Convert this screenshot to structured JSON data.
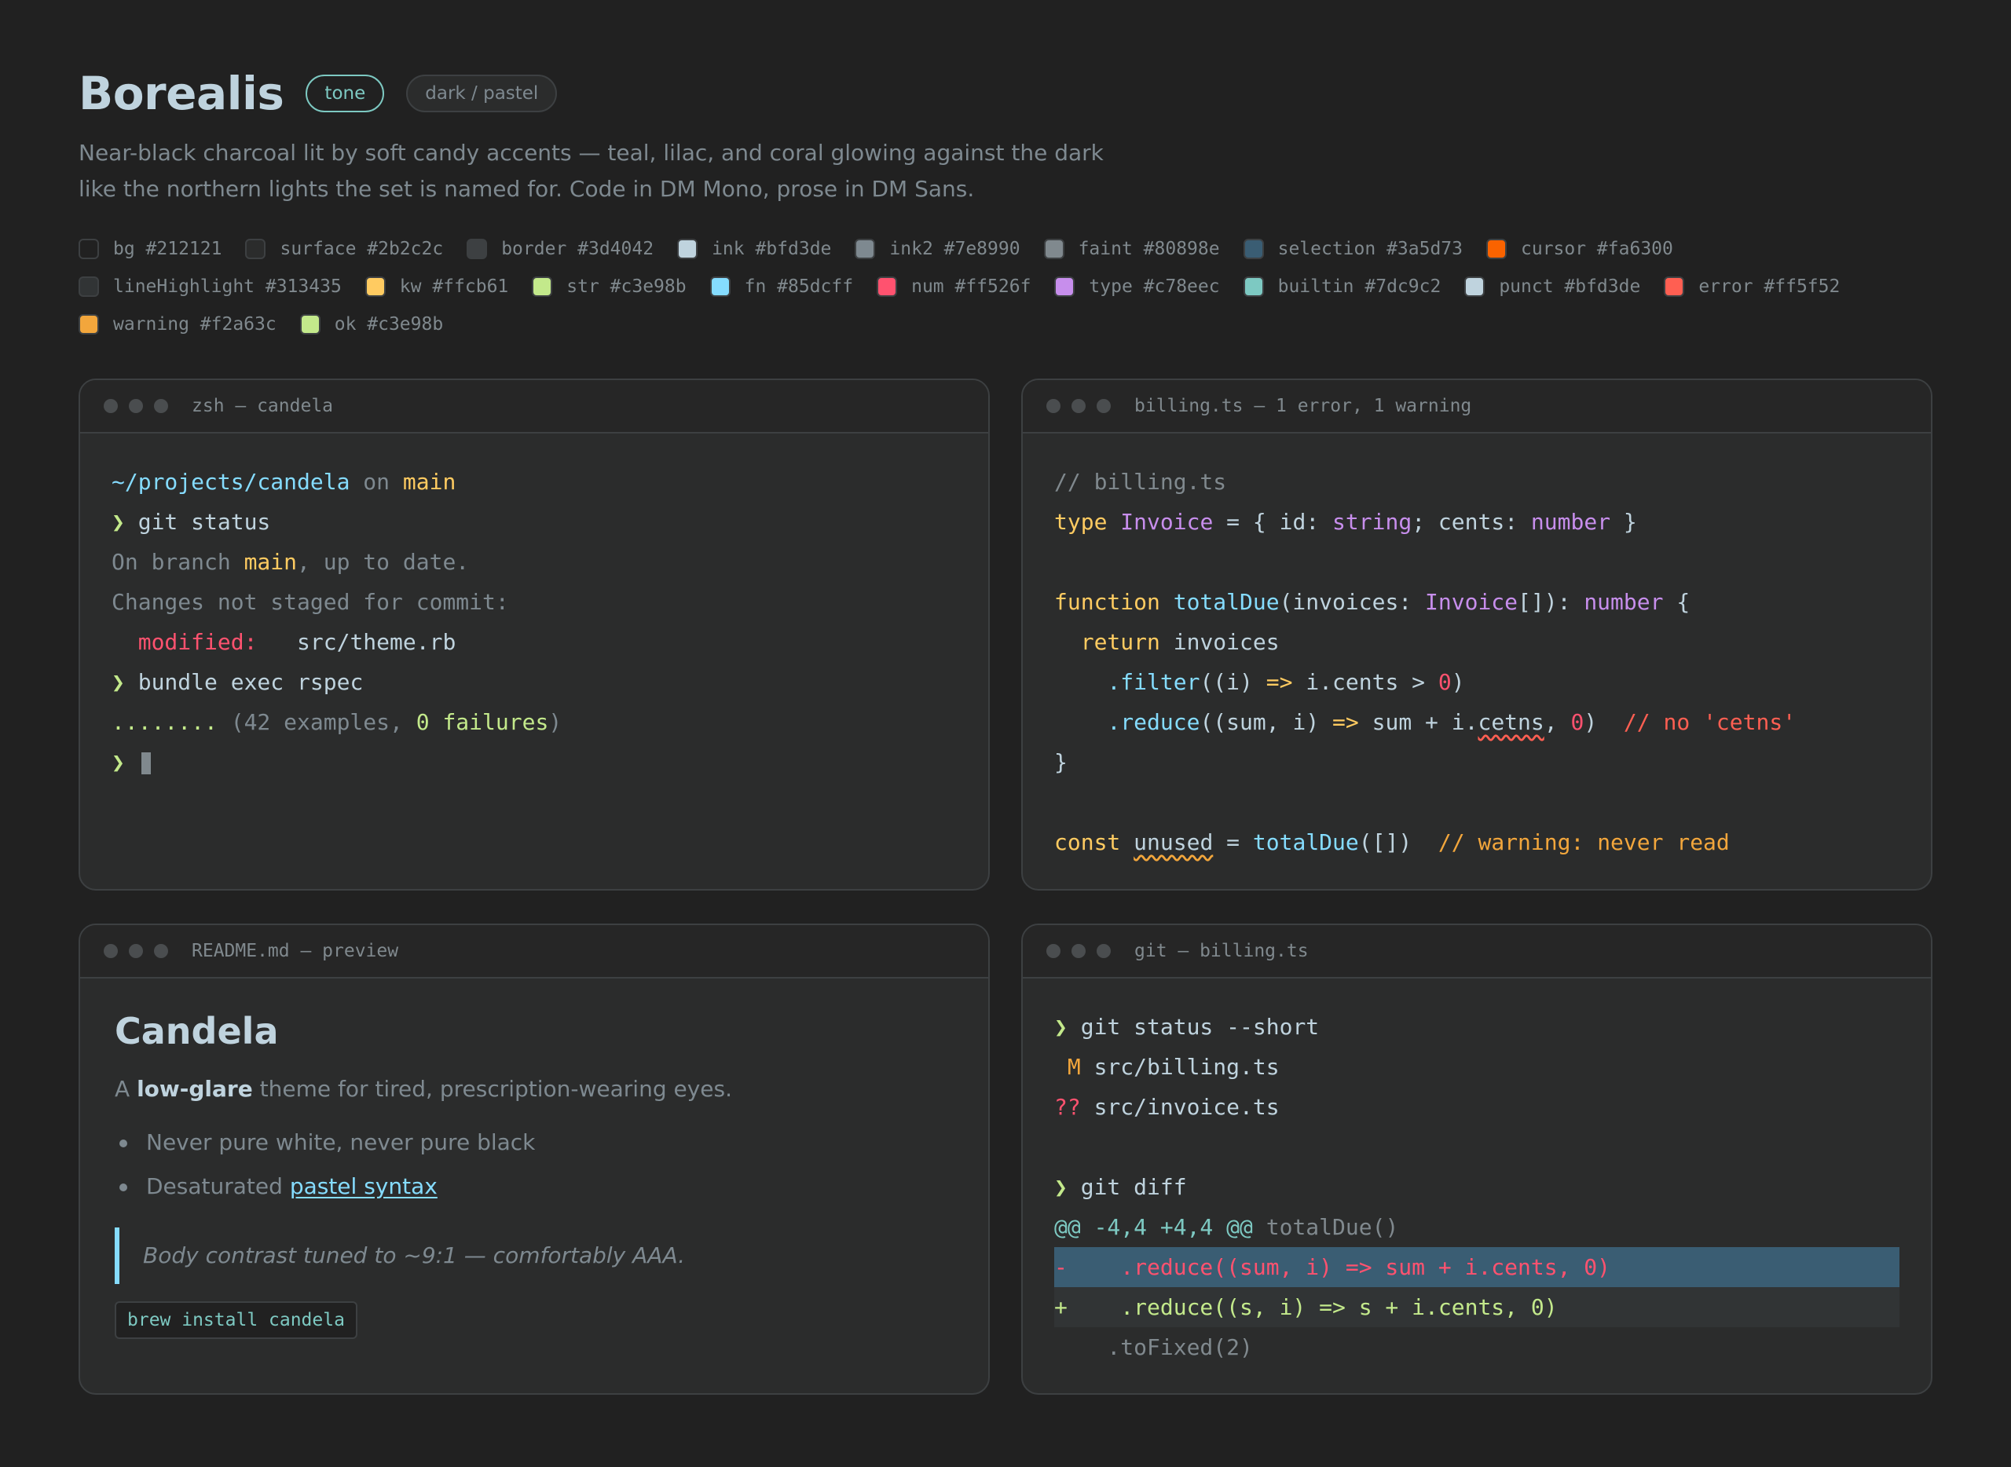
{
  "header": {
    "title": "Borealis",
    "tag_tone": "tone",
    "tag_mode": "dark / pastel",
    "description": "Near-black charcoal lit by soft candy accents — teal, lilac, and coral glowing against the dark like the northern lights the set is named for. Code in DM Mono, prose in DM Sans."
  },
  "palette": [
    {
      "label": "bg #212121",
      "color": "#212121"
    },
    {
      "label": "surface #2b2c2c",
      "color": "#2b2c2c"
    },
    {
      "label": "border #3d4042",
      "color": "#3d4042"
    },
    {
      "label": "ink #bfd3de",
      "color": "#bfd3de"
    },
    {
      "label": "ink2 #7e8990",
      "color": "#7e8990"
    },
    {
      "label": "faint #80898e",
      "color": "#80898e"
    },
    {
      "label": "selection #3a5d73",
      "color": "#3a5d73"
    },
    {
      "label": "cursor #fa6300",
      "color": "#fa6300"
    },
    {
      "label": "lineHighlight #313435",
      "color": "#313435"
    },
    {
      "label": "kw #ffcb61",
      "color": "#ffcb61"
    },
    {
      "label": "str #c3e98b",
      "color": "#c3e98b"
    },
    {
      "label": "fn #85dcff",
      "color": "#85dcff"
    },
    {
      "label": "num #ff526f",
      "color": "#ff526f"
    },
    {
      "label": "type #c78eec",
      "color": "#c78eec"
    },
    {
      "label": "builtin #7dc9c2",
      "color": "#7dc9c2"
    },
    {
      "label": "punct #bfd3de",
      "color": "#bfd3de"
    },
    {
      "label": "error #ff5f52",
      "color": "#ff5f52"
    },
    {
      "label": "warning #f2a63c",
      "color": "#f2a63c"
    },
    {
      "label": "ok #c3e98b",
      "color": "#c3e98b"
    }
  ],
  "terminal": {
    "title": "zsh — candela",
    "path": "~/projects/candela",
    "on": "on",
    "branch": "main",
    "prompt": "❯",
    "cmd1": "git status",
    "on_branch_prefix": "On branch ",
    "on_branch_suffix": ", up to date.",
    "changes": "Changes not staged for commit:",
    "modified_label": "modified:",
    "modified_file": "src/theme.rb",
    "cmd2": "bundle exec rspec",
    "dots": "........",
    "examples_open": "(42 examples, ",
    "failures": "0 failures",
    "examples_close": ")"
  },
  "editor": {
    "title": "billing.ts — 1 error, 1 warning",
    "comment": "// billing.ts",
    "kw_type": "type",
    "type_invoice": "Invoice",
    "eq_open": " = { id: ",
    "t_string": "string",
    "cents_sep": "; cents: ",
    "t_number": "number",
    "close_brace": " }",
    "kw_function": "function",
    "fn_total": "totalDue",
    "params_open": "(invoices: ",
    "params_arr": "[]): ",
    "open_brace": " {",
    "kw_return": "return",
    "invoices": " invoices",
    "filter": ".filter",
    "filter_args": "((i) ",
    "arrow": "=>",
    "filter_body": " i.cents > ",
    "zero": "0",
    "rparen": ")",
    "reduce": ".reduce",
    "reduce_args": "((sum, i) ",
    "reduce_body": " sum + i.",
    "cetns": "cetns",
    "comma_sp": ", ",
    "err_comment": "// no 'cetns'",
    "rbrace": "}",
    "kw_const": "const",
    "unused": "unused",
    "eq": " = ",
    "call_args": "([])",
    "warn_comment": "// warning: never read"
  },
  "readme": {
    "title": "README.md — preview",
    "h1": "Candela",
    "p_a": "A ",
    "p_bold": "low-glare",
    "p_rest": " theme for tired, prescription-wearing eyes.",
    "li1": "Never pure white, never pure black",
    "li2_prefix": "Desaturated ",
    "li2_link": "pastel syntax",
    "quote": "Body contrast tuned to ~9:1 — comfortably AAA.",
    "code": "brew install candela"
  },
  "git": {
    "title": "git — billing.ts",
    "prompt": "❯",
    "cmd1": "git status --short",
    "m_flag": " M",
    "m_file": " src/billing.ts",
    "q_flag": "??",
    "q_file": " src/invoice.ts",
    "cmd2": "git diff",
    "hunk": "@@ -4,4 +4,4 @@",
    "hunk_ctx": " totalDue()",
    "del_line": "-    .reduce((sum, i) => sum + i.cents, 0)",
    "add_line": "+    .reduce((s, i) => s + i.cents, 0)",
    "ctx_line": "    .toFixed(2)"
  }
}
